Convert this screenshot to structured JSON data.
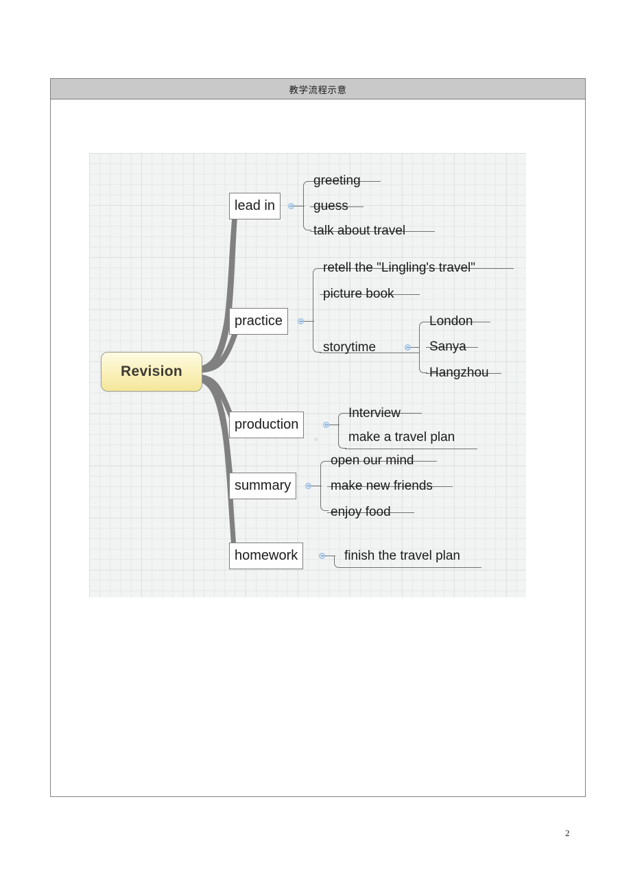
{
  "document": {
    "page_number": "2",
    "table_header_title": "教学流程示意"
  },
  "mindmap": {
    "root": {
      "label": "Revision"
    },
    "toggle_icon": "collapse-toggle-icon",
    "branches": [
      {
        "label": "lead in",
        "children": [
          {
            "label": "greeting"
          },
          {
            "label": "guess"
          },
          {
            "label": "talk about travel"
          }
        ]
      },
      {
        "label": "practice",
        "children": [
          {
            "label": "retell the \"Lingling's travel\""
          },
          {
            "label": "picture book"
          },
          {
            "label": "storytime",
            "children": [
              {
                "label": "London"
              },
              {
                "label": "Sanya"
              },
              {
                "label": "Hangzhou"
              }
            ]
          }
        ]
      },
      {
        "label": "production",
        "children": [
          {
            "label": "Interview"
          },
          {
            "label": "make a travel plan"
          }
        ]
      },
      {
        "label": "summary",
        "children": [
          {
            "label": "open our mind"
          },
          {
            "label": "make new friends"
          },
          {
            "label": "enjoy food"
          }
        ]
      },
      {
        "label": "homework",
        "children": [
          {
            "label": "finish the travel plan"
          }
        ]
      }
    ]
  },
  "colors": {
    "root_fill": "#f4e79a",
    "node_border": "#7d7d7d",
    "branch_stroke": "#808080",
    "canvas_bg": "#f2f4f3",
    "header_bg": "#c9c9c9",
    "toggle_fill": "#cfe0f2"
  }
}
